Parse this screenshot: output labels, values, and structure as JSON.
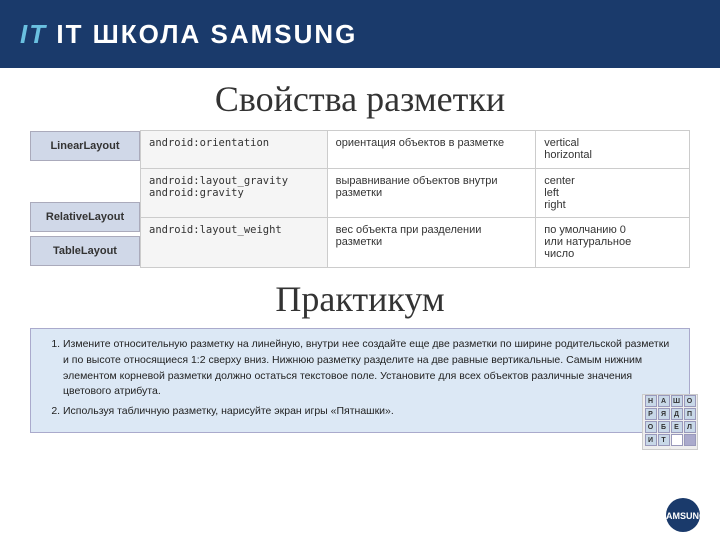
{
  "header": {
    "brand": "IT ШКОЛА SAMSUNG"
  },
  "page": {
    "title": "Свойства разметки",
    "section2": "Практикум"
  },
  "sidebar": {
    "items": [
      {
        "label": "LinearLayout"
      },
      {
        "label": "RelativeLayout"
      },
      {
        "label": "TableLayout"
      }
    ]
  },
  "table": {
    "rows": [
      {
        "attr": "android:orientation",
        "desc": "ориентация объектов в разметке",
        "values": "vertical\nhorizontal"
      },
      {
        "attr": "android:layout_gravity\nandroid:gravity",
        "desc": "выравнивание объектов внутри разметки",
        "values": "center\nleft\nright"
      },
      {
        "attr": "android:layout_weight",
        "desc": "вес объекта при разделении разметки",
        "values": "по умолчанию 0\nили натуральное\nчисло"
      }
    ]
  },
  "practice": {
    "items": [
      "Измените относительную разметку на линейную, внутри нее создайте еще две разметки по ширине родительской разметки и по высоте относящиеся 1:2 сверху вниз. Нижнюю разметку разделите на две равные вертикальные. Самым нижним элементом корневой разметки должно остаться текстовое поле. Установите для всех объектов различные значения цветового атрибута.",
      "Используя табличную разметку, нарисуйте экран игры «Пятнашки»."
    ]
  },
  "puzzle": {
    "cells": [
      "Н",
      "А",
      "Ш",
      "О",
      "Р",
      "Я",
      "Д",
      "П",
      "О",
      "Б",
      "Е",
      "Л",
      "И",
      "Т",
      "",
      ""
    ]
  }
}
